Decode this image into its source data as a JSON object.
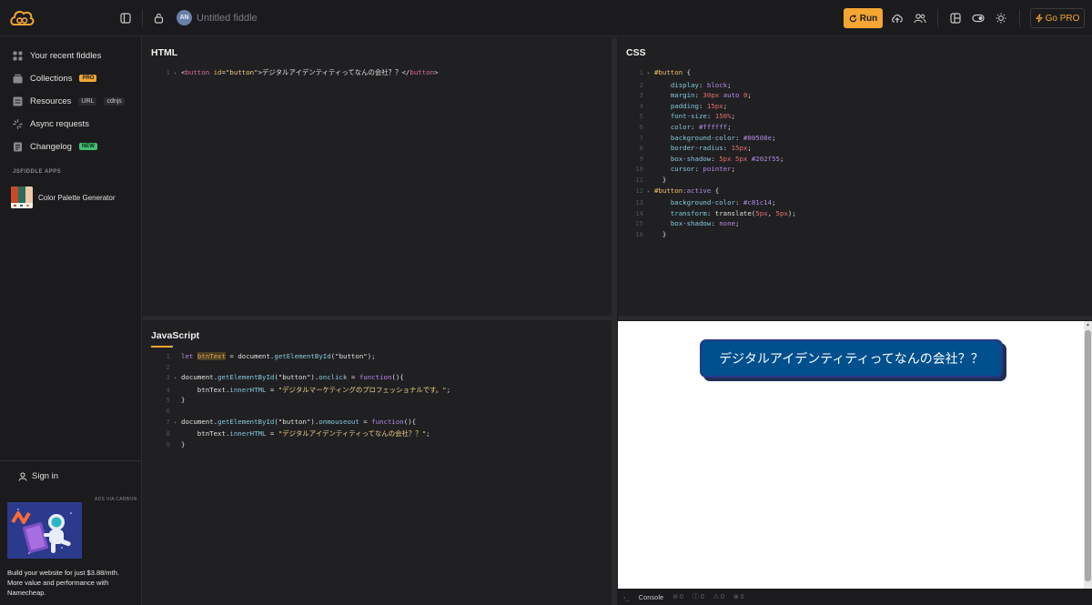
{
  "topbar": {
    "fiddle_title": "Untitled fiddle",
    "avatar_initials": "AN",
    "run_label": "Run",
    "gopro_label": "Go PRO",
    "accent": "#f4a532"
  },
  "sidebar": {
    "items": [
      {
        "label": "Your recent fiddles",
        "icon": "grid-icon"
      },
      {
        "label": "Collections",
        "icon": "collections-icon",
        "badge": "PRO"
      },
      {
        "label": "Resources",
        "icon": "resources-icon",
        "tags": [
          "URL",
          "cdnjs"
        ]
      },
      {
        "label": "Async requests",
        "icon": "spinner-icon"
      },
      {
        "label": "Changelog",
        "icon": "changelog-icon",
        "badge": "NEW"
      }
    ],
    "apps_heading": "JSFIDDLE APPS",
    "app": {
      "label": "Color Palette Generator"
    },
    "signin_label": "Sign in",
    "ad_label": "ADS VIA CARBON",
    "ad_text": "Build your website for just $3.88/mth. More value and performance with Namecheap."
  },
  "html_pane": {
    "title": "HTML",
    "lines": [
      {
        "n": "1",
        "parts": [
          [
            "tok-pl",
            "<"
          ],
          [
            "tok-tag",
            "button"
          ],
          [
            "tok-pl",
            " "
          ],
          [
            "tok-attr",
            "id"
          ],
          [
            "tok-pl",
            "="
          ],
          [
            "tok-str",
            "\"button\""
          ],
          [
            "tok-pl",
            ">"
          ],
          [
            "tok-text",
            "デジタルアイデンティティってなんの会社？？"
          ],
          [
            "tok-pl",
            "</"
          ],
          [
            "tok-tag",
            "button"
          ],
          [
            "tok-pl",
            ">"
          ]
        ],
        "fold": true
      }
    ]
  },
  "css_pane": {
    "title": "CSS",
    "lines": [
      {
        "n": "1",
        "fold": true,
        "parts": [
          [
            "tok-sel",
            "#button"
          ],
          [
            "tok-pl",
            " {"
          ]
        ]
      },
      {
        "n": "2",
        "parts": [
          [
            "tok-pl",
            "    "
          ],
          [
            "tok-prop",
            "display"
          ],
          [
            "tok-pl",
            ": "
          ],
          [
            "tok-val",
            "block"
          ],
          [
            "tok-pl",
            ";"
          ]
        ]
      },
      {
        "n": "3",
        "parts": [
          [
            "tok-pl",
            "    "
          ],
          [
            "tok-prop",
            "margin"
          ],
          [
            "tok-pl",
            ": "
          ],
          [
            "tok-num",
            "30px"
          ],
          [
            "tok-pl",
            " "
          ],
          [
            "tok-val",
            "auto"
          ],
          [
            "tok-pl",
            " "
          ],
          [
            "tok-num",
            "0"
          ],
          [
            "tok-pl",
            ";"
          ]
        ]
      },
      {
        "n": "4",
        "parts": [
          [
            "tok-pl",
            "    "
          ],
          [
            "tok-prop",
            "padding"
          ],
          [
            "tok-pl",
            ": "
          ],
          [
            "tok-num",
            "15px"
          ],
          [
            "tok-pl",
            ";"
          ]
        ]
      },
      {
        "n": "5",
        "parts": [
          [
            "tok-pl",
            "    "
          ],
          [
            "tok-prop",
            "font-size"
          ],
          [
            "tok-pl",
            ": "
          ],
          [
            "tok-num",
            "150%"
          ],
          [
            "tok-pl",
            ";"
          ]
        ]
      },
      {
        "n": "6",
        "parts": [
          [
            "tok-pl",
            "    "
          ],
          [
            "tok-prop",
            "color"
          ],
          [
            "tok-pl",
            ": "
          ],
          [
            "tok-val",
            "#ffffff"
          ],
          [
            "tok-pl",
            ";"
          ]
        ]
      },
      {
        "n": "7",
        "parts": [
          [
            "tok-pl",
            "    "
          ],
          [
            "tok-prop",
            "background-color"
          ],
          [
            "tok-pl",
            ": "
          ],
          [
            "tok-val",
            "#00508e"
          ],
          [
            "tok-pl",
            ";"
          ]
        ]
      },
      {
        "n": "8",
        "parts": [
          [
            "tok-pl",
            "    "
          ],
          [
            "tok-prop",
            "border-radius"
          ],
          [
            "tok-pl",
            ": "
          ],
          [
            "tok-num",
            "15px"
          ],
          [
            "tok-pl",
            ";"
          ]
        ]
      },
      {
        "n": "9",
        "parts": [
          [
            "tok-pl",
            "    "
          ],
          [
            "tok-prop",
            "box-shadow"
          ],
          [
            "tok-pl",
            ": "
          ],
          [
            "tok-num",
            "5px"
          ],
          [
            "tok-pl",
            " "
          ],
          [
            "tok-num",
            "5px"
          ],
          [
            "tok-pl",
            " "
          ],
          [
            "tok-val",
            "#202f55"
          ],
          [
            "tok-pl",
            ";"
          ]
        ]
      },
      {
        "n": "10",
        "parts": [
          [
            "tok-pl",
            "    "
          ],
          [
            "tok-prop",
            "cursor"
          ],
          [
            "tok-pl",
            ": "
          ],
          [
            "tok-val",
            "pointer"
          ],
          [
            "tok-pl",
            ";"
          ]
        ]
      },
      {
        "n": "11",
        "parts": [
          [
            "tok-pl",
            "  }"
          ]
        ]
      },
      {
        "n": "12",
        "fold": true,
        "parts": [
          [
            "tok-sel",
            "#button"
          ],
          [
            "tok-val",
            ":active"
          ],
          [
            "tok-pl",
            " {"
          ]
        ]
      },
      {
        "n": "13",
        "parts": [
          [
            "tok-pl",
            "    "
          ],
          [
            "tok-prop",
            "background-color"
          ],
          [
            "tok-pl",
            ": "
          ],
          [
            "tok-val",
            "#c81c14"
          ],
          [
            "tok-pl",
            ";"
          ]
        ]
      },
      {
        "n": "14",
        "parts": [
          [
            "tok-pl",
            "    "
          ],
          [
            "tok-prop",
            "transform"
          ],
          [
            "tok-pl",
            ": translate("
          ],
          [
            "tok-num",
            "5px"
          ],
          [
            "tok-pl",
            ", "
          ],
          [
            "tok-num",
            "5px"
          ],
          [
            "tok-pl",
            ");"
          ]
        ]
      },
      {
        "n": "15",
        "parts": [
          [
            "tok-pl",
            "    "
          ],
          [
            "tok-prop",
            "box-shadow"
          ],
          [
            "tok-pl",
            ": "
          ],
          [
            "tok-val",
            "none"
          ],
          [
            "tok-pl",
            ";"
          ]
        ]
      },
      {
        "n": "16",
        "parts": [
          [
            "tok-pl",
            "  }"
          ]
        ]
      }
    ]
  },
  "js_pane": {
    "title": "JavaScript",
    "lines": [
      {
        "n": "1",
        "parts": [
          [
            "tok-kw",
            "let "
          ],
          [
            "tok-var hl",
            "btnText"
          ],
          [
            "tok-pl",
            " = document."
          ],
          [
            "tok-fn",
            "getElementById"
          ],
          [
            "tok-pl",
            "(\"button\");"
          ]
        ]
      },
      {
        "n": "2",
        "parts": []
      },
      {
        "n": "3",
        "fold": true,
        "parts": [
          [
            "tok-pl",
            "document."
          ],
          [
            "tok-fn",
            "getElementById"
          ],
          [
            "tok-pl",
            "(\"button\")."
          ],
          [
            "tok-fn",
            "onclick"
          ],
          [
            "tok-pl",
            " = "
          ],
          [
            "tok-kw",
            "function"
          ],
          [
            "tok-pl",
            "(){"
          ]
        ]
      },
      {
        "n": "4",
        "parts": [
          [
            "tok-pl",
            "    btnText."
          ],
          [
            "tok-fn",
            "innerHTML"
          ],
          [
            "tok-pl",
            " = "
          ],
          [
            "tok-str",
            "\"デジタルマーケティングのプロフェッショナルです。\""
          ],
          [
            "tok-pl",
            ";"
          ]
        ]
      },
      {
        "n": "5",
        "parts": [
          [
            "tok-pl",
            "}"
          ]
        ]
      },
      {
        "n": "6",
        "parts": []
      },
      {
        "n": "7",
        "fold": true,
        "parts": [
          [
            "tok-pl",
            "document."
          ],
          [
            "tok-fn",
            "getElementById"
          ],
          [
            "tok-pl",
            "(\"button\")."
          ],
          [
            "tok-fn",
            "onmouseout"
          ],
          [
            "tok-pl",
            " = "
          ],
          [
            "tok-kw",
            "function"
          ],
          [
            "tok-pl",
            "(){"
          ]
        ]
      },
      {
        "n": "8",
        "parts": [
          [
            "tok-pl",
            "    btnText."
          ],
          [
            "tok-fn",
            "innerHTML"
          ],
          [
            "tok-pl",
            " = "
          ],
          [
            "tok-str",
            "\"デジタルアイデンティティってなんの会社？？\""
          ],
          [
            "tok-pl",
            ";"
          ]
        ]
      },
      {
        "n": "9",
        "parts": [
          [
            "tok-pl",
            "}"
          ]
        ]
      }
    ]
  },
  "result": {
    "button_text": "デジタルアイデンティティってなんの会社？？",
    "button_bg": "#00508e",
    "button_shadow": "#202f55"
  },
  "console": {
    "label": "Console",
    "counts": [
      "0",
      "0",
      "0",
      "0"
    ]
  }
}
